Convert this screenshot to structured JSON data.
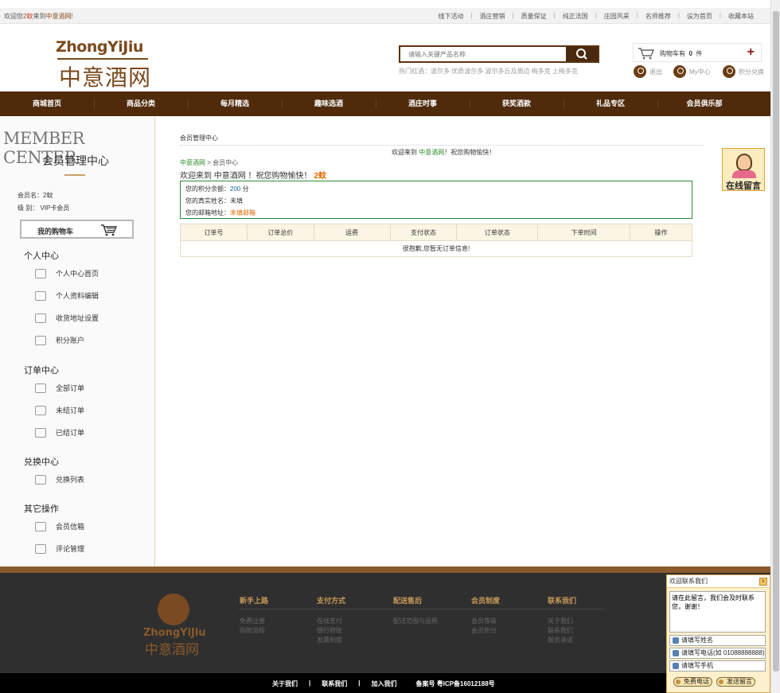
{
  "topbar": {
    "welcome_prefix": "欢迎您",
    "user": "2蚊",
    "welcome_mid": "来到",
    "site": "中意酒网!",
    "links": [
      "线下活动",
      "酒庄营销",
      "质量保证",
      "纯正法国",
      "庄园风采",
      "名师推荐",
      "设为首页",
      "收藏本站"
    ]
  },
  "logo": {
    "en": "ZhongYiJiu",
    "cn": "中意酒网"
  },
  "search": {
    "placeholder": "请输入关键产品名称",
    "hot": "热门红酒：波尔多 优质波尔多 波尔多丘及周边 梅多克 上梅多克"
  },
  "cart": {
    "label": "购物车有",
    "count": "0",
    "unit": "件"
  },
  "user_links": [
    "退出",
    "My中心",
    "积分兑换"
  ],
  "nav": [
    "商城首页",
    "商品分类",
    "每月精选",
    "趣味选酒",
    "酒庄时事",
    "获奖酒款",
    "礼品专区",
    "会员俱乐部"
  ],
  "side": {
    "title_en": "MEMBER CENTER",
    "title_cn": "会员管理中心",
    "member_name": "会员名：2蚊",
    "member_level": "级  别： VIP卡会员",
    "cart_btn": "我的购物车",
    "sections": [
      {
        "title": "个人中心",
        "items": [
          "个人中心首页",
          "个人资料编辑",
          "收货地址设置",
          "积分账户"
        ]
      },
      {
        "title": "订单中心",
        "items": [
          "全部订单",
          "未结订单",
          "已结订单"
        ]
      },
      {
        "title": "兑换中心",
        "items": [
          "兑换列表"
        ]
      },
      {
        "title": "其它操作",
        "items": [
          "会员信箱",
          "评论管理"
        ]
      }
    ]
  },
  "main": {
    "title": "会员管理中心",
    "welcome_a": "欢迎来到",
    "welcome_site": "中意酒网",
    "welcome_b": "！祝您购物愉快！",
    "crumb_home": "中意酒网",
    "crumb_sep": ">",
    "crumb_cur": "会员中心",
    "welcome2_a": "欢迎来到 中意酒网 ！祝您购物愉快！",
    "welcome2_num": "2蚊",
    "points_label": "您的积分余额：",
    "points_value": "200",
    "points_unit": " 分",
    "realname_label": "您的真实姓名：",
    "realname_value": "未填",
    "email_label": "您的邮箱地址：",
    "email_value": "未填邮箱",
    "table_headers": [
      "订单号",
      "订单总价",
      "运费",
      "支付状态",
      "订单状态",
      "下单时间",
      "操作"
    ],
    "table_empty": "很抱歉,您暂无订单信息!"
  },
  "float_msg": "在线留言",
  "footer": {
    "logo_en": "ZhongYiJiu",
    "logo_cn": "中意酒网",
    "cols": [
      {
        "h": "新手上路",
        "l": [
          "免费注册",
          "购物流程"
        ]
      },
      {
        "h": "支付方式",
        "l": [
          "在线支付",
          "银行转账",
          "发票制度"
        ]
      },
      {
        "h": "配送售后",
        "l": [
          "配送范围与运费"
        ]
      },
      {
        "h": "会员制度",
        "l": [
          "会员等级",
          "会员积分"
        ]
      },
      {
        "h": "联系我们",
        "l": [
          "关于我们",
          "联系我们",
          "服务承诺"
        ]
      }
    ],
    "bottom_links": [
      "关于我们",
      "|",
      "联系我们",
      "|",
      "加入我们"
    ],
    "icp": "备案号 粤ICP备16012188号"
  },
  "contact": {
    "title": "欢迎联系我们",
    "close": "×",
    "message": "请在此留言，我们会及时联系您，谢谢！",
    "name_ph": "请填写姓名",
    "phone_ph": "请填写电话(如 01088888888)",
    "mobile_ph": "请填写手机",
    "btn_call": "免费电话",
    "btn_send": "发送留言"
  }
}
